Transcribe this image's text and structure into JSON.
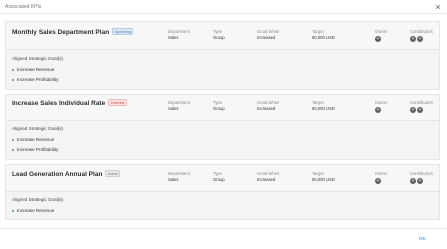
{
  "dialog": {
    "title": "Associated KPIs",
    "close_glyph": "×",
    "ok_label": "OK"
  },
  "field_labels": {
    "department": "Department",
    "type": "Type",
    "good_when": "Good When",
    "target": "Target",
    "owner": "Owner",
    "contributors": "Contributors"
  },
  "goals_heading": "Aligned Strategic Goal(s)",
  "kpis": [
    {
      "name": "Monthly Sales Department Plan",
      "status": "Upcoming",
      "status_color": "#4b74b0",
      "department": "Sales",
      "type": "Group",
      "good_when": "Increased",
      "target": "50,000 USD",
      "owner_avatar": "user-avatar-icon",
      "contributor_avatars": [
        "user-avatar-icon",
        "user-avatar-icon"
      ],
      "goals": [
        "Increase Revenue",
        "Increase Profitability"
      ]
    },
    {
      "name": "Increase Sales Individual Rate",
      "status": "Overdue",
      "status_color": "#c54a3e",
      "department": "Sales",
      "type": "Group",
      "good_when": "Increased",
      "target": "50,000 USD",
      "owner_avatar": "user-avatar-icon",
      "contributor_avatars": [
        "user-avatar-icon",
        "user-avatar-icon"
      ],
      "goals": [
        "Increase Revenue",
        "Increase Profitability"
      ]
    },
    {
      "name": "Lead Generation Annual Plan",
      "status": "Active",
      "status_color": "#7a7a7a",
      "department": "Sales",
      "type": "Group",
      "good_when": "Increased",
      "target": "50,000 USD",
      "owner_avatar": "user-avatar-icon",
      "contributor_avatars": [
        "user-avatar-icon",
        "user-avatar-icon"
      ],
      "goals": [
        "Increase Revenue"
      ]
    }
  ]
}
